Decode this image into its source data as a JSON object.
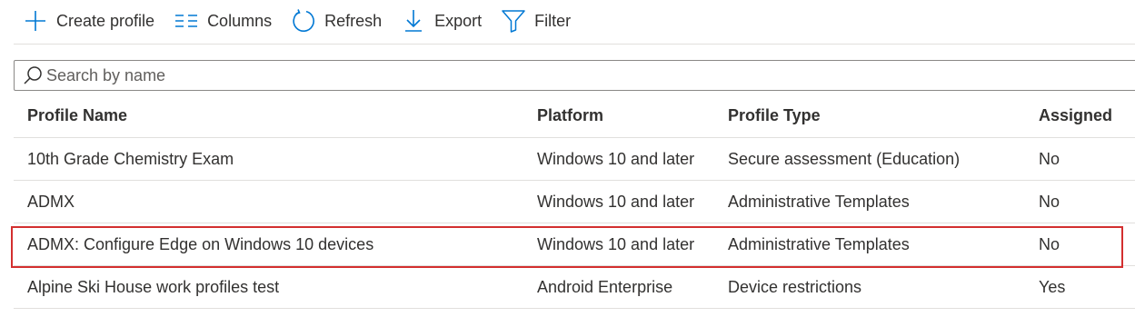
{
  "toolbar": {
    "create_profile": "Create profile",
    "columns": "Columns",
    "refresh": "Refresh",
    "export": "Export",
    "filter": "Filter"
  },
  "search": {
    "placeholder": "Search by name",
    "value": ""
  },
  "table": {
    "headers": {
      "name": "Profile Name",
      "platform": "Platform",
      "type": "Profile Type",
      "assigned": "Assigned"
    },
    "rows": [
      {
        "name": "10th Grade Chemistry Exam",
        "platform": "Windows 10 and later",
        "type": "Secure assessment (Education)",
        "assigned": "No"
      },
      {
        "name": "ADMX",
        "platform": "Windows 10 and later",
        "type": "Administrative Templates",
        "assigned": "No"
      },
      {
        "name": "ADMX: Configure Edge on Windows 10 devices",
        "platform": "Windows 10 and later",
        "type": "Administrative Templates",
        "assigned": "No"
      },
      {
        "name": "Alpine Ski House work profiles test",
        "platform": "Android Enterprise",
        "type": "Device restrictions",
        "assigned": "Yes"
      }
    ]
  },
  "colors": {
    "accent": "#0078d4",
    "highlight": "#d32f2f",
    "divider": "#e1dfdd",
    "text": "#323130"
  },
  "icons": {
    "create_profile": "plus-icon",
    "columns": "columns-icon",
    "refresh": "refresh-icon",
    "export": "download-icon",
    "filter": "filter-icon",
    "search": "search-icon"
  }
}
